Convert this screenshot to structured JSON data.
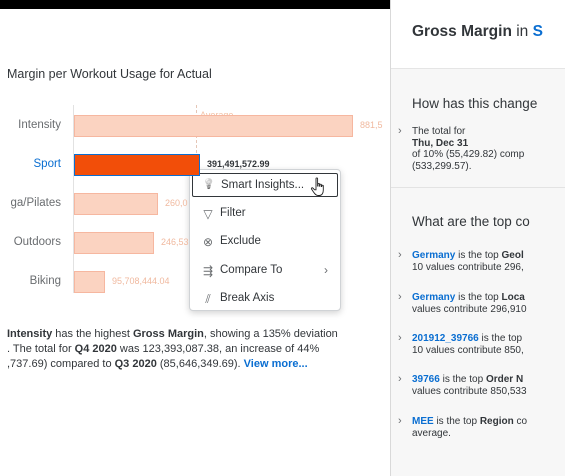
{
  "chart": {
    "title": "Margin per Workout Usage for Actual",
    "average_label": "Average",
    "categories": [
      {
        "label": "Intensity",
        "value_label": "881,5",
        "fraction": 0.93,
        "selected": false
      },
      {
        "label": "Sport",
        "value_label": "391,491,572.99",
        "fraction": 0.42,
        "selected": true
      },
      {
        "label": "ga/Pilates",
        "value_label": "260,0",
        "fraction": 0.28,
        "selected": false
      },
      {
        "label": "Outdoors",
        "value_label": "246,53",
        "fraction": 0.265,
        "selected": false
      },
      {
        "label": "Biking",
        "value_label": "95,708,444.04",
        "fraction": 0.102,
        "selected": false
      }
    ],
    "colors": {
      "bar": "#fbd3c1",
      "bar_selected": "#f24e09",
      "accent": "#0a6ed1"
    }
  },
  "chart_data": {
    "type": "bar",
    "orientation": "horizontal",
    "title": "Margin per Workout Usage for Actual",
    "categories": [
      "Intensity",
      "Sport",
      "ga/Pilates",
      "Outdoors",
      "Biking"
    ],
    "values": [
      881500000,
      391491572.99,
      260000000,
      246530000,
      95708444.04
    ],
    "annotations": [
      "Average"
    ]
  },
  "context_menu": {
    "items": [
      {
        "label": "Smart Insights...",
        "icon": "lightbulb-icon",
        "glyph": "💡",
        "focused": true,
        "submenu": false
      },
      {
        "label": "Filter",
        "icon": "filter-icon",
        "glyph": "▽",
        "focused": false,
        "submenu": false
      },
      {
        "label": "Exclude",
        "icon": "exclude-icon",
        "glyph": "⊗",
        "focused": false,
        "submenu": false
      },
      {
        "label": "Compare To",
        "icon": "compare-icon",
        "glyph": "⇶",
        "focused": false,
        "submenu": true
      },
      {
        "label": "Break Axis",
        "icon": "break-axis-icon",
        "glyph": "⫽",
        "focused": false,
        "submenu": false
      }
    ],
    "submenu_glyph": "›"
  },
  "summary": {
    "l1_a": "Intensity",
    "l1_b": " has the highest ",
    "l1_c": "Gross Margin",
    "l1_d": ", showing a 135% deviation",
    "l2_a": ". The total for ",
    "l2_b": "Q4 2020",
    "l2_c": " was 123,393,087.38, an increase of 44%",
    "l3_a": ",737.69) compared to ",
    "l3_b": "Q3 2020",
    "l3_c": " (85,646,349.69). ",
    "link": "View more..."
  },
  "panel": {
    "title_a": "Gross Margin",
    "title_in": " in ",
    "title_b": "S",
    "q1": "How has this change",
    "change": {
      "l1_a": "The total for ",
      "l1_b": "Thu, Dec 31",
      "l2": "of 10% (55,429.82) comp",
      "l3": "(533,299.57)."
    },
    "q2": "What are the top co",
    "insights": [
      {
        "entity": "Germany",
        "l1_rest": " is the top ",
        "l1_bold": "Geol",
        "l2": "10 values contribute 296,"
      },
      {
        "entity": "Germany",
        "l1_rest": " is the top ",
        "l1_bold": "Loca",
        "l2": "values contribute 296,910"
      },
      {
        "entity": "201912_39766",
        "l1_rest": " is the top",
        "l1_bold": "",
        "l2": "10 values contribute 850,"
      },
      {
        "entity": "39766",
        "l1_rest": " is the top ",
        "l1_bold": "Order N",
        "l2": "values contribute 850,533"
      },
      {
        "entity": "MEE",
        "l1_rest": " is the top ",
        "l1_bold": "Region",
        "l1_tail": " co",
        "l2": "average."
      }
    ],
    "chevron": "›"
  }
}
